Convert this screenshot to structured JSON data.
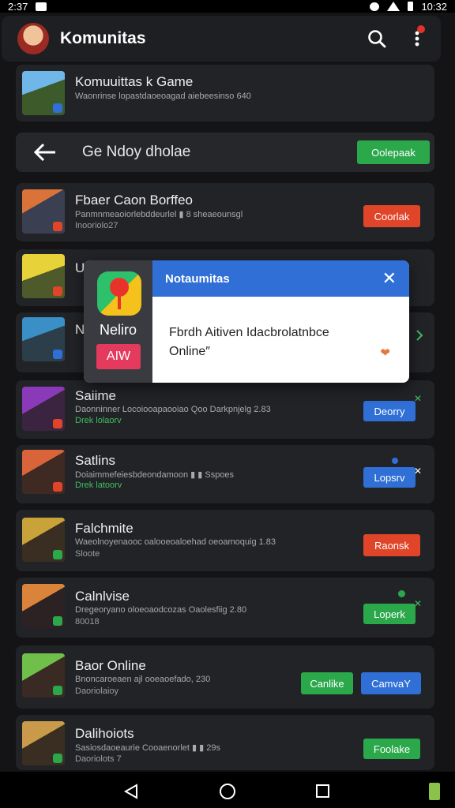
{
  "status_bar": {
    "time_left": "2:37",
    "time_right": "10:32"
  },
  "app_bar": {
    "title": "Komunitas"
  },
  "featured": {
    "title": "Komuuittas k Game",
    "desc": "Waonrinse lopastdaoeoagad aiebeesinso 640"
  },
  "group_header": {
    "title": "Ge Ndoy dholae",
    "button_label": "Oolepaak"
  },
  "games": [
    {
      "title": "Fbaer Caon Borffeo",
      "desc": "Panmnmeaoiorlebddeurlel ▮ 8 sheaeounsgl",
      "sub": "Inooriolo27",
      "sub_green": false,
      "buttons": [
        {
          "label": "Coorlak",
          "color": "red"
        }
      ]
    },
    {
      "title": "U",
      "desc": "",
      "sub": "",
      "sub_green": false,
      "buttons": []
    },
    {
      "title": "N",
      "desc": "",
      "sub": "",
      "sub_green": false,
      "buttons": []
    },
    {
      "title": "Saiime",
      "desc": "Daonninner Locoiooapaooiao Qoo Darkpnjelg 2.83",
      "sub": "Drek lolaorv",
      "sub_green": true,
      "buttons": [
        {
          "label": "Deorry",
          "color": "blue"
        }
      ]
    },
    {
      "title": "Satlins",
      "desc": "Doiaimmefeiesbdeondamoon ▮ ▮ Sspoes",
      "sub": "Drek latoorv",
      "sub_green": true,
      "buttons": [
        {
          "label": "Lopsrv",
          "color": "blue"
        }
      ]
    },
    {
      "title": "Falchmite",
      "desc": "Waeolnoyenaooc oalooeoaloehad oeoamoquig 1.83",
      "sub": "Sloote",
      "sub_green": false,
      "buttons": [
        {
          "label": "Raonsk",
          "color": "red"
        }
      ]
    },
    {
      "title": "Calnlvise",
      "desc": "Dregeoryano oloeoaodcozas Oaolesfiig 2.80",
      "sub": "80018",
      "sub_green": false,
      "buttons": [
        {
          "label": "Loperk",
          "color": "green"
        }
      ]
    },
    {
      "title": "Baor Online",
      "desc": "Bnoncaroeaen ajl ooeaoefado, 230",
      "sub": "Daoriolaioy",
      "sub_green": false,
      "buttons": [
        {
          "label": "Canlike",
          "color": "green"
        },
        {
          "label": "CamvaY",
          "color": "blue"
        }
      ]
    },
    {
      "title": "Dalihoiots",
      "desc": "Sasiosdaoeaurie Cooaenorlet ▮ ▮ 29s",
      "sub": "Daoriolots 7",
      "sub_green": false,
      "buttons": [
        {
          "label": "Foolake",
          "color": "green"
        }
      ]
    }
  ],
  "popup": {
    "left_label": "Neliro",
    "left_badge": "AIW",
    "title": "Notaumitas",
    "body_line1": "Fbrdh Aitiven Idacbrolatnbce",
    "body_line2": "Online″",
    "close": "✕",
    "heart": "❤"
  },
  "colors": {
    "red": "#e0452a",
    "blue": "#2f6fd6",
    "green": "#2aa84a",
    "card": "#222327"
  },
  "icons": [
    "search-icon",
    "more-vert-icon",
    "back-arrow-icon",
    "close-icon",
    "heart-icon",
    "nav-back-icon",
    "nav-home-icon",
    "nav-recent-icon"
  ]
}
